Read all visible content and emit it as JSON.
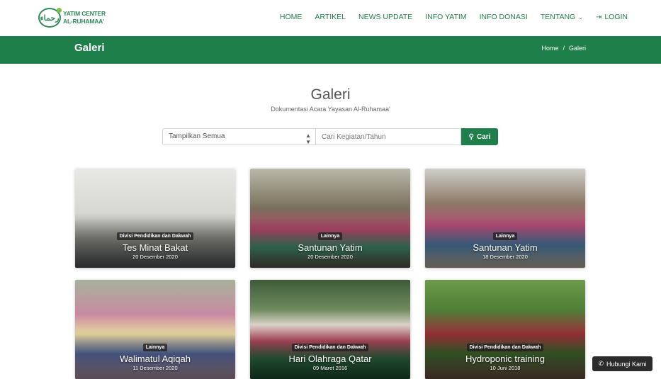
{
  "logo": {
    "mark": "ﺭﺣﻤﺎء",
    "line1": "YATIM CENTER",
    "line2": "AL-RUHAMAA'"
  },
  "nav": {
    "items": [
      "HOME",
      "ARTIKEL",
      "NEWS UPDATE",
      "INFO YATIM",
      "INFO DONASI",
      "TENTANG"
    ],
    "login": "LOGIN",
    "chevron": "⌄",
    "login_icon": "⇥"
  },
  "banner": {
    "title": "Galeri",
    "crumb_home": "Home",
    "crumb_sep": "/",
    "crumb_current": "Galeri"
  },
  "section": {
    "title": "Galeri",
    "subtitle": "Dokumentasi Acara Yayasan Al-Ruhamaa'"
  },
  "search": {
    "filter_selected": "Tampilkan Semua",
    "placeholder": "Cari Kegiatan/Tahun",
    "button": "Cari",
    "button_icon": "⚲"
  },
  "cards": [
    {
      "category": "Divisi Pendidikan dan Dakwah",
      "title": "Tes Minat Bakat",
      "date": "20 Desember 2020"
    },
    {
      "category": "Lainnya",
      "title": "Santunan Yatim",
      "date": "20 Desember 2020"
    },
    {
      "category": "Lainnya",
      "title": "Santunan Yatim",
      "date": "18 Desember 2020"
    },
    {
      "category": "Lainnya",
      "title": "Walimatul Aqiqah",
      "date": "11 Desember 2020"
    },
    {
      "category": "Divisi Pendidikan dan Dakwah",
      "title": "Hari Olahraga Qatar",
      "date": "09 Maret 2016"
    },
    {
      "category": "Divisi Pendidikan dan Dakwah",
      "title": "Hydroponic training",
      "date": "10 Juni 2018"
    }
  ],
  "floating": {
    "label": "Hubungi Kami",
    "icon": "✆"
  },
  "colors": {
    "brand_green": "#1e7f4b",
    "nav_green": "#247d4c"
  }
}
